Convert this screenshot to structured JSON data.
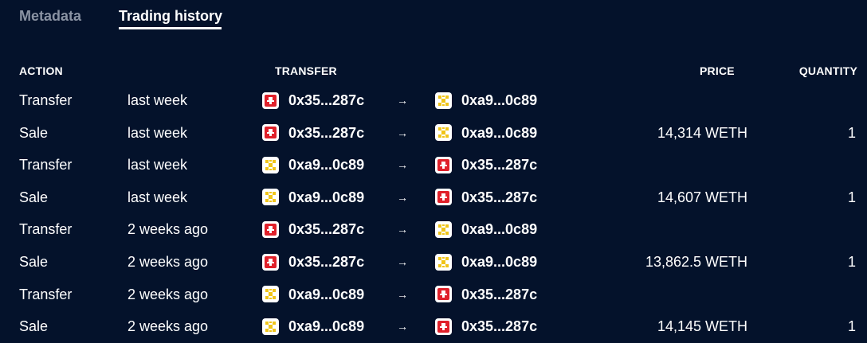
{
  "tabs": [
    {
      "label": "Metadata",
      "active": false
    },
    {
      "label": "Trading history",
      "active": true
    }
  ],
  "table": {
    "headers": {
      "action": "ACTION",
      "transfer": "TRANSFER",
      "price": "PRICE",
      "quantity": "QUANTITY"
    },
    "arrow": "→",
    "rows": [
      {
        "action": "Transfer",
        "time": "last week",
        "from": "0x35...287c",
        "from_avatar": "red",
        "to": "0xa9...0c89",
        "to_avatar": "yellow",
        "price": "",
        "quantity": ""
      },
      {
        "action": "Sale",
        "time": "last week",
        "from": "0x35...287c",
        "from_avatar": "red",
        "to": "0xa9...0c89",
        "to_avatar": "yellow",
        "price": "14,314 WETH",
        "quantity": "1"
      },
      {
        "action": "Transfer",
        "time": "last week",
        "from": "0xa9...0c89",
        "from_avatar": "yellow",
        "to": "0x35...287c",
        "to_avatar": "red",
        "price": "",
        "quantity": ""
      },
      {
        "action": "Sale",
        "time": "last week",
        "from": "0xa9...0c89",
        "from_avatar": "yellow",
        "to": "0x35...287c",
        "to_avatar": "red",
        "price": "14,607 WETH",
        "quantity": "1"
      },
      {
        "action": "Transfer",
        "time": "2 weeks ago",
        "from": "0x35...287c",
        "from_avatar": "red",
        "to": "0xa9...0c89",
        "to_avatar": "yellow",
        "price": "",
        "quantity": ""
      },
      {
        "action": "Sale",
        "time": "2 weeks ago",
        "from": "0x35...287c",
        "from_avatar": "red",
        "to": "0xa9...0c89",
        "to_avatar": "yellow",
        "price": "13,862.5 WETH",
        "quantity": "1"
      },
      {
        "action": "Transfer",
        "time": "2 weeks ago",
        "from": "0xa9...0c89",
        "from_avatar": "yellow",
        "to": "0x35...287c",
        "to_avatar": "red",
        "price": "",
        "quantity": ""
      },
      {
        "action": "Sale",
        "time": "2 weeks ago",
        "from": "0xa9...0c89",
        "from_avatar": "yellow",
        "to": "0x35...287c",
        "to_avatar": "red",
        "price": "14,145 WETH",
        "quantity": "1"
      }
    ]
  },
  "colors": {
    "background": "#04122b",
    "tab_inactive": "#8a93a3",
    "avatar_red": "#e0202a",
    "avatar_yellow": "#f0c419"
  }
}
